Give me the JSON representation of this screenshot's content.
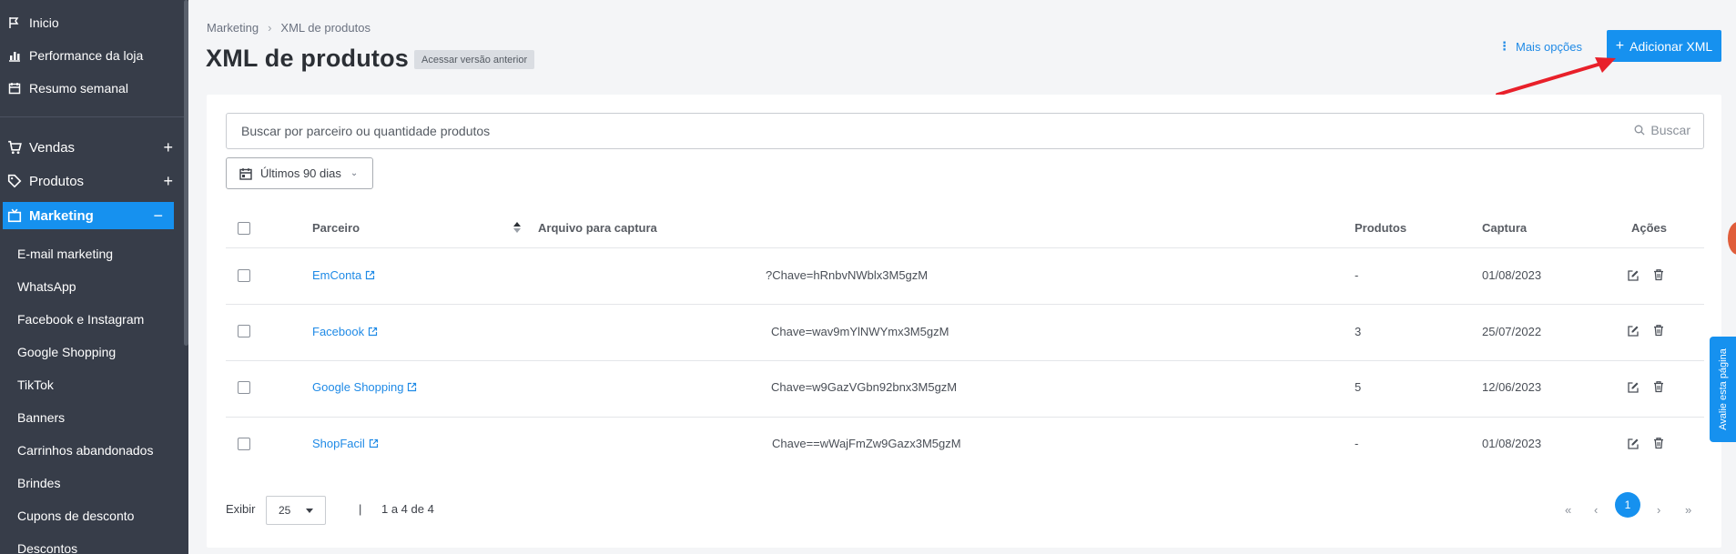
{
  "sidebar": {
    "top_items": [
      {
        "label": "Inicio",
        "icon": "flag-icon"
      },
      {
        "label": "Performance da loja",
        "icon": "bar-chart-icon"
      },
      {
        "label": "Resumo semanal",
        "icon": "calendar-icon"
      }
    ],
    "main_items": [
      {
        "label": "Vendas",
        "icon": "cart-icon",
        "toggle": "+"
      },
      {
        "label": "Produtos",
        "icon": "tag-icon",
        "toggle": "+"
      },
      {
        "label": "Marketing",
        "icon": "tv-icon",
        "toggle": "−",
        "active": true
      }
    ],
    "sub_items": [
      "E-mail marketing",
      "WhatsApp",
      "Facebook e Instagram",
      "Google Shopping",
      "TikTok",
      "Banners",
      "Carrinhos abandonados",
      "Brindes",
      "Cupons de desconto",
      "Descontos"
    ]
  },
  "header": {
    "breadcrumb": [
      "Marketing",
      "XML de produtos"
    ],
    "breadcrumb_separator": "›",
    "title": "XML de produtos",
    "old_version_label": "Acessar versão anterior",
    "more_options_label": "Mais opções",
    "add_button_label": "Adicionar XML"
  },
  "search": {
    "placeholder": "Buscar por parceiro ou quantidade produtos",
    "button_label": "Buscar"
  },
  "date_filter": {
    "label": "Últimos 90 dias"
  },
  "table": {
    "columns": [
      "Parceiro",
      "Arquivo para captura",
      "Produtos",
      "Captura",
      "Ações"
    ],
    "rows": [
      {
        "partner": "EmConta",
        "file": "?Chave=hRnbvNWblx3M5gzM",
        "products": "-",
        "capture": "01/08/2023"
      },
      {
        "partner": "Facebook",
        "file": "Chave=wav9mYlNWYmx3M5gzM",
        "products": "3",
        "capture": "25/07/2022"
      },
      {
        "partner": "Google Shopping",
        "file": "Chave=w9GazVGbn92bnx3M5gzM",
        "products": "5",
        "capture": "12/06/2023"
      },
      {
        "partner": "ShopFacil",
        "file": "Chave==wWajFmZw9Gazx3M5gzM",
        "products": "-",
        "capture": "01/08/2023"
      }
    ]
  },
  "footer": {
    "show_label": "Exibir",
    "per_page": "25",
    "pipe": "|",
    "count_text": "1 a 4 de 4",
    "pagination": {
      "first": "«",
      "prev": "‹",
      "current": "1",
      "next": "›",
      "last": "»"
    }
  },
  "feedback_tab": {
    "label": "Avalie esta página"
  },
  "colors": {
    "accent": "#1691ef",
    "sidebar_bg": "#373d49",
    "annotation_arrow": "#e8202a"
  }
}
